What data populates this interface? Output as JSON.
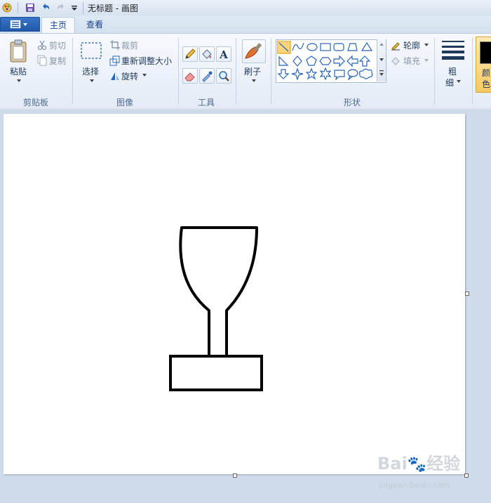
{
  "title": "无标题 - 画图",
  "tabs": [
    {
      "label": "主页",
      "active": true
    },
    {
      "label": "查看",
      "active": false
    }
  ],
  "clipboard": {
    "paste": "粘贴",
    "cut": "剪切",
    "copy": "复制",
    "group": "剪贴板"
  },
  "image": {
    "select": "选择",
    "crop": "裁剪",
    "resize": "重新调整大小",
    "rotate": "旋转",
    "group": "图像"
  },
  "tools": {
    "group": "工具"
  },
  "brushes": {
    "label": "刷子"
  },
  "shapes": {
    "outline": "轮廓",
    "fill": "填充",
    "group": "形状"
  },
  "size": {
    "label_1": "粗",
    "label_2": "细"
  },
  "color": {
    "label_1": "颜",
    "label_2": "色",
    "swatch": "#000000"
  },
  "watermark": {
    "brand": "Bai",
    "brand2": "经验",
    "url": "jingyan.baidu.com"
  },
  "colors": {
    "accent": "#2b65b8",
    "ribbon_bg": "#eef3fa",
    "canvas_bg": "#ffffff"
  }
}
